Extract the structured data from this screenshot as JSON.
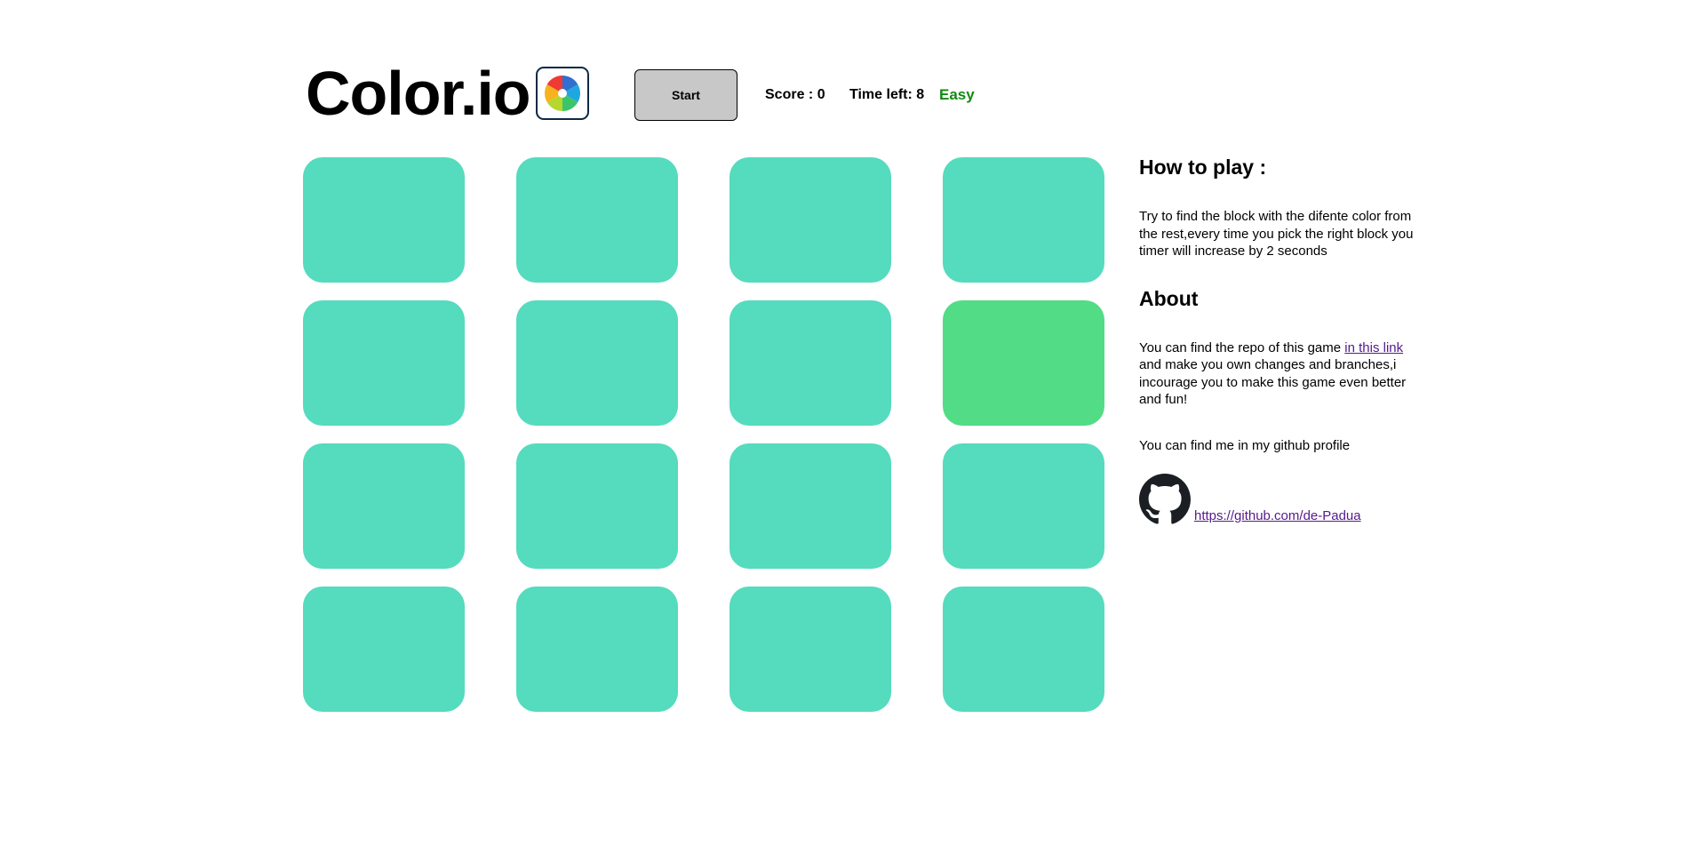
{
  "header": {
    "title": "Color.io",
    "logo_icon": "color-wheel-icon"
  },
  "controls": {
    "start_label": "Start",
    "score_text": "Score : 0",
    "time_text": "Time left: 8",
    "difficulty_text": "Easy",
    "difficulty_color": "#118a11"
  },
  "board": {
    "base_color": "#55dbbd",
    "odd_color": "#52dc85",
    "rows": 4,
    "columns": 4,
    "odd_block": {
      "row": 2,
      "column": 4
    }
  },
  "sidebar": {
    "howto_title": "How to play :",
    "howto_text": "Try to find the block with the difente color from the rest,every time you pick the right block you timer will increase by 2 seconds",
    "about_title": "About",
    "about_text_before": "You can find the repo of this game ",
    "about_link_text": "in this link",
    "about_text_after": " and make you own changes and branches,i incourage you to make this game even better and fun!",
    "profile_text": "You can find me in my github profile",
    "github_icon": "github-icon",
    "github_link_text": " https://github.com/de-Padua"
  },
  "colors": {
    "link": "#551a8b",
    "button_bg": "#c8c8c8"
  }
}
